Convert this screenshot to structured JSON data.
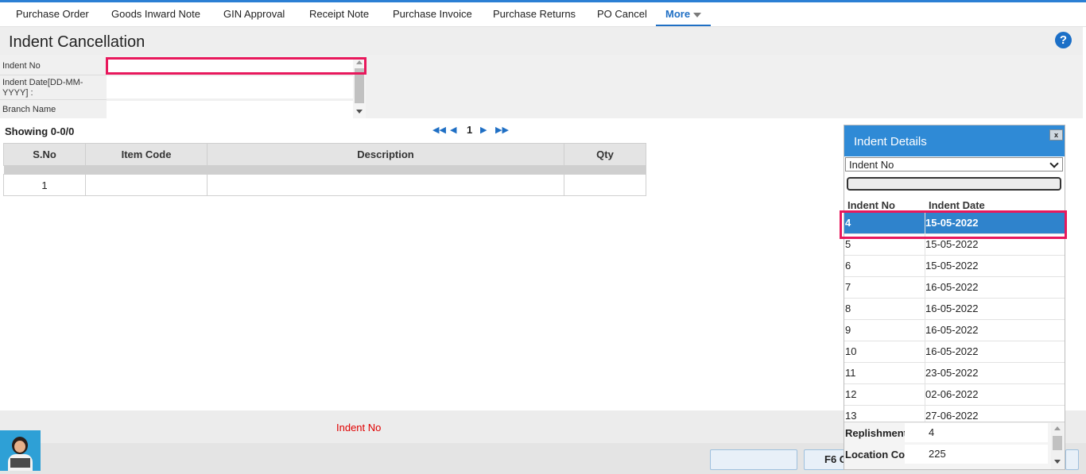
{
  "tabs": [
    {
      "label": "Purchase Order"
    },
    {
      "label": "Goods Inward Note"
    },
    {
      "label": "GIN Approval"
    },
    {
      "label": "Receipt Note"
    },
    {
      "label": "Purchase Invoice"
    },
    {
      "label": "Purchase Returns"
    },
    {
      "label": "PO Cancel"
    },
    {
      "label": "More"
    }
  ],
  "page": {
    "title": "Indent Cancellation",
    "help": "?"
  },
  "form": {
    "indent_no_label": "Indent No",
    "indent_date_label": "Indent Date[DD-MM-YYYY] :",
    "branch_label": "Branch Name",
    "indent_no_value": "",
    "indent_date_value": "",
    "branch_value": ""
  },
  "pager": {
    "showing": "Showing 0-0/0",
    "page": "1"
  },
  "table": {
    "headers": [
      "S.No",
      "Item Code",
      "Description",
      "Qty"
    ],
    "rows": [
      [
        "1",
        "",
        "",
        ""
      ]
    ]
  },
  "footer": {
    "message": "Indent No",
    "button2_label": "F6 C"
  },
  "panel": {
    "title": "Indent Details",
    "close": "x",
    "select_value": "Indent No",
    "col_indent_no": "Indent No",
    "col_indent_date": "Indent Date",
    "rows": [
      {
        "no": "4",
        "date": "15-05-2022"
      },
      {
        "no": "5",
        "date": "15-05-2022"
      },
      {
        "no": "6",
        "date": "15-05-2022"
      },
      {
        "no": "7",
        "date": "16-05-2022"
      },
      {
        "no": "8",
        "date": "16-05-2022"
      },
      {
        "no": "9",
        "date": "16-05-2022"
      },
      {
        "no": "10",
        "date": "16-05-2022"
      },
      {
        "no": "11",
        "date": "23-05-2022"
      },
      {
        "no": "12",
        "date": "02-06-2022"
      },
      {
        "no": "13",
        "date": "27-06-2022"
      }
    ],
    "replishment_label": "Replishment No",
    "replishment_value": "4",
    "location_label": "Location Code",
    "location_value": "225"
  },
  "colors": {
    "accent": "#2f8ad6",
    "highlight": "#e8185c",
    "error": "#e00000"
  }
}
